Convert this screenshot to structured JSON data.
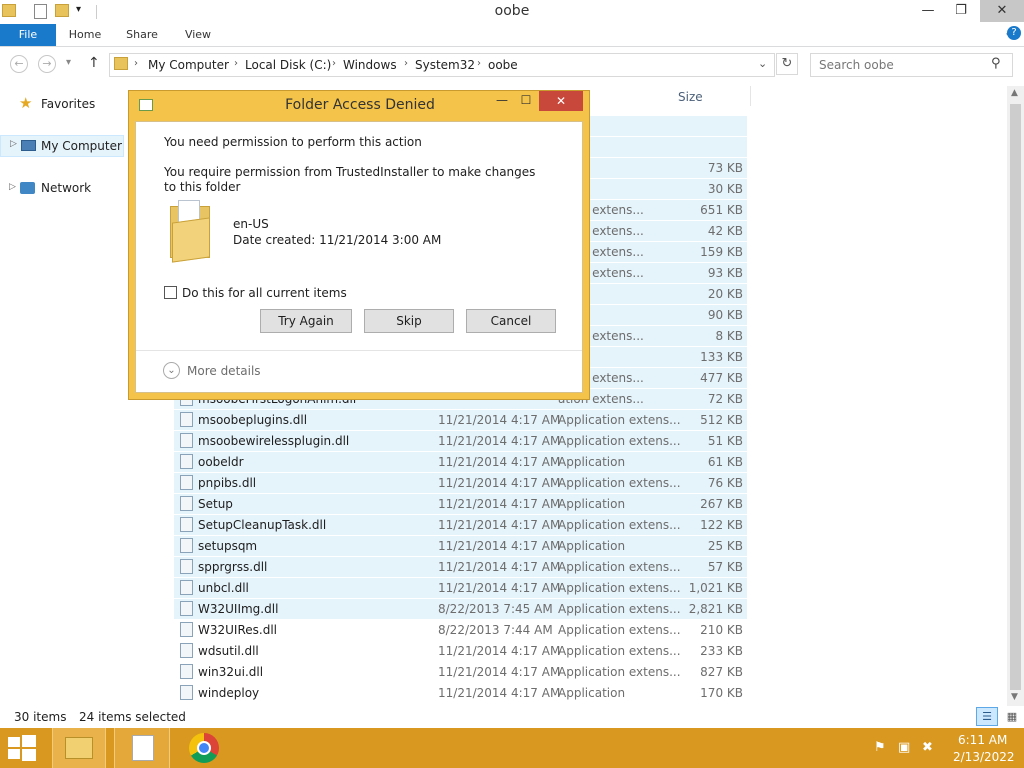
{
  "window": {
    "title": "oobe",
    "controls": {
      "minimize": "—",
      "maximize": "❐",
      "close": "✕"
    }
  },
  "ribbon": {
    "tabs": [
      {
        "label": "File"
      },
      {
        "label": "Home"
      },
      {
        "label": "Share"
      },
      {
        "label": "View"
      }
    ]
  },
  "address": {
    "breadcrumbs": [
      {
        "label": "My Computer"
      },
      {
        "label": "Local Disk (C:)"
      },
      {
        "label": "Windows"
      },
      {
        "label": "System32"
      },
      {
        "label": "oobe"
      }
    ],
    "search_placeholder": "Search oobe"
  },
  "nav": {
    "items": [
      {
        "label": "Favorites"
      },
      {
        "label": "My Computer"
      },
      {
        "label": "Network"
      }
    ]
  },
  "list": {
    "size_header": "Size",
    "rows": [
      {
        "name": "",
        "date": "",
        "type": "lder",
        "size": ""
      },
      {
        "name": "",
        "date": "",
        "type": "lder",
        "size": ""
      },
      {
        "name": "",
        "date": "",
        "type": "ation",
        "size": "73 KB"
      },
      {
        "name": "",
        "date": "",
        "type": "ation",
        "size": "30 KB"
      },
      {
        "name": "",
        "date": "",
        "type": "ation extens...",
        "size": "651 KB"
      },
      {
        "name": "",
        "date": "",
        "type": "ation extens...",
        "size": "42 KB"
      },
      {
        "name": "",
        "date": "",
        "type": "ation extens...",
        "size": "159 KB"
      },
      {
        "name": "",
        "date": "",
        "type": "ation extens...",
        "size": "93 KB"
      },
      {
        "name": "",
        "date": "",
        "type": "ation",
        "size": "20 KB"
      },
      {
        "name": "",
        "date": "",
        "type": "File",
        "size": "90 KB"
      },
      {
        "name": "",
        "date": "",
        "type": "ation extens...",
        "size": "8 KB"
      },
      {
        "name": "",
        "date": "",
        "type": "ation",
        "size": "133 KB"
      },
      {
        "name": "",
        "date": "",
        "type": "ation extens...",
        "size": "477 KB"
      },
      {
        "name": "msoobeFirstLogonAnim.dll",
        "date": "",
        "type": "ation extens...",
        "size": "72 KB"
      },
      {
        "name": "msoobeplugins.dll",
        "date": "11/21/2014 4:17 AM",
        "type": "Application extens...",
        "size": "512 KB"
      },
      {
        "name": "msoobewirelessplugin.dll",
        "date": "11/21/2014 4:17 AM",
        "type": "Application extens...",
        "size": "51 KB"
      },
      {
        "name": "oobeldr",
        "date": "11/21/2014 4:17 AM",
        "type": "Application",
        "size": "61 KB"
      },
      {
        "name": "pnpibs.dll",
        "date": "11/21/2014 4:17 AM",
        "type": "Application extens...",
        "size": "76 KB"
      },
      {
        "name": "Setup",
        "date": "11/21/2014 4:17 AM",
        "type": "Application",
        "size": "267 KB"
      },
      {
        "name": "SetupCleanupTask.dll",
        "date": "11/21/2014 4:17 AM",
        "type": "Application extens...",
        "size": "122 KB"
      },
      {
        "name": "setupsqm",
        "date": "11/21/2014 4:17 AM",
        "type": "Application",
        "size": "25 KB"
      },
      {
        "name": "spprgrss.dll",
        "date": "11/21/2014 4:17 AM",
        "type": "Application extens...",
        "size": "57 KB"
      },
      {
        "name": "unbcl.dll",
        "date": "11/21/2014 4:17 AM",
        "type": "Application extens...",
        "size": "1,021 KB"
      },
      {
        "name": "W32UIImg.dll",
        "date": "8/22/2013 7:45 AM",
        "type": "Application extens...",
        "size": "2,821 KB"
      },
      {
        "name": "W32UIRes.dll",
        "date": "8/22/2013 7:44 AM",
        "type": "Application extens...",
        "size": "210 KB"
      },
      {
        "name": "wdsutil.dll",
        "date": "11/21/2014 4:17 AM",
        "type": "Application extens...",
        "size": "233 KB"
      },
      {
        "name": "win32ui.dll",
        "date": "11/21/2014 4:17 AM",
        "type": "Application extens...",
        "size": "827 KB"
      },
      {
        "name": "windeploy",
        "date": "11/21/2014 4:17 AM",
        "type": "Application",
        "size": "170 KB"
      }
    ]
  },
  "status": {
    "items_count": "30 items",
    "selected_count": "24 items selected"
  },
  "dialog": {
    "title": "Folder Access Denied",
    "heading": "You need permission to perform this action",
    "message": "You require permission from TrustedInstaller to make changes to this folder",
    "folder_name": "en-US",
    "date_created": "Date created: 11/21/2014 3:00 AM",
    "checkbox_label": "Do this for all current items",
    "buttons": {
      "try_again": "Try Again",
      "skip": "Skip",
      "cancel": "Cancel"
    },
    "more_details": "More details"
  },
  "clock": {
    "time": "6:11 AM",
    "date": "2/13/2022"
  },
  "colors": {
    "accent": "#1979ca",
    "dialog_frame": "#f3c34a",
    "taskbar": "#d9981f",
    "close_red": "#c9483c",
    "selection": "#e5f3fb"
  }
}
